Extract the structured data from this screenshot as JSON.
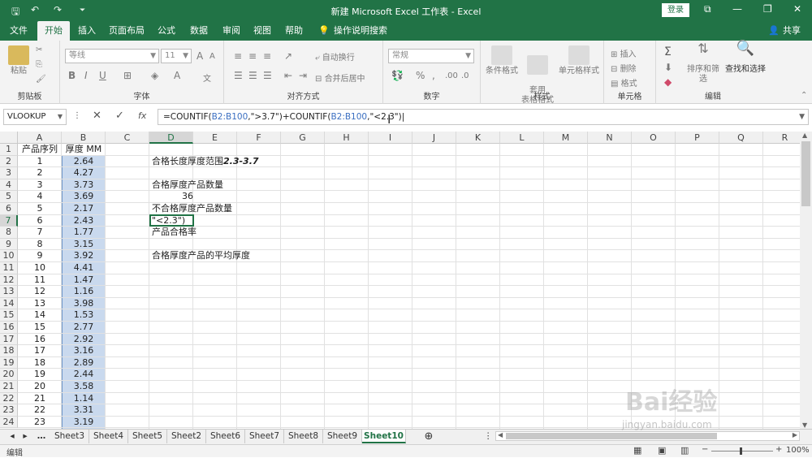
{
  "titlebar": {
    "title": "新建 Microsoft Excel 工作表 - Excel",
    "login": "登录",
    "qa_save": "🖫",
    "qa_undo": "↶",
    "qa_redo": "↷",
    "qa_custom": "⏷",
    "win_ribbon": "⧉",
    "win_min": "—",
    "win_max": "❐",
    "win_close": "✕"
  },
  "tabs": [
    "文件",
    "开始",
    "插入",
    "页面布局",
    "公式",
    "数据",
    "审阅",
    "视图",
    "帮助"
  ],
  "tell_me": "操作说明搜索",
  "share": "共享",
  "ribbon": {
    "clipboard": {
      "label": "剪贴板",
      "paste": "粘贴"
    },
    "font": {
      "label": "字体",
      "font_name": "等线",
      "font_size": "11",
      "bold": "B",
      "italic": "I",
      "underline": "U",
      "grow": "A",
      "shrink": "A",
      "fill": "A"
    },
    "alignment": {
      "label": "对齐方式",
      "wrap": "自动换行",
      "merge": "合并后居中"
    },
    "number": {
      "label": "数字",
      "format": "常规",
      "percent": "%",
      "comma": ","
    },
    "styles": {
      "label": "样式",
      "conditional": "条件格式",
      "table": "套用\n表格格式",
      "cell": "单元格样式"
    },
    "cells": {
      "label": "单元格",
      "insert": "插入",
      "delete": "删除",
      "format": "格式"
    },
    "editing": {
      "label": "编辑",
      "sort": "排序和筛选",
      "find": "查找和选择"
    }
  },
  "formula_bar": {
    "name_box": "VLOOKUP",
    "cancel": "✕",
    "enter": "✓",
    "fx": "fx",
    "formula_parts": [
      "=COUNTIF(",
      "B2:B100",
      ",\">3.7\")+COUNTIF(",
      "B2:B100",
      ",\"<2.3\")"
    ]
  },
  "columns": [
    "A",
    "B",
    "C",
    "D",
    "E",
    "F",
    "G",
    "H",
    "I",
    "J",
    "K",
    "L",
    "M",
    "N",
    "O",
    "P",
    "Q",
    "R"
  ],
  "rows": [
    "1",
    "2",
    "3",
    "4",
    "5",
    "6",
    "7",
    "8",
    "9",
    "10",
    "11",
    "12",
    "13",
    "14",
    "15",
    "16",
    "17",
    "18",
    "19",
    "20",
    "21",
    "22",
    "23",
    "24"
  ],
  "header_a": "产品序列",
  "header_b": "厚度 MM",
  "col_a": [
    "1",
    "2",
    "3",
    "4",
    "5",
    "6",
    "7",
    "8",
    "9",
    "10",
    "11",
    "12",
    "13",
    "14",
    "15",
    "16",
    "17",
    "18",
    "19",
    "20",
    "21",
    "22",
    "23"
  ],
  "col_b": [
    "2.64",
    "4.27",
    "3.73",
    "3.69",
    "2.17",
    "2.43",
    "1.77",
    "3.15",
    "3.92",
    "4.41",
    "1.47",
    "1.16",
    "3.98",
    "1.53",
    "2.77",
    "2.92",
    "3.16",
    "2.89",
    "2.44",
    "3.58",
    "1.14",
    "3.31",
    "3.19"
  ],
  "d_cells": {
    "d2_prefix": "合格长度厚度范围",
    "d2_range": "2.3-3.7",
    "d4": "合格厚度产品数量",
    "d5": "36",
    "d6": "不合格厚度产品数量",
    "d7": "\"<2.3\")",
    "d8": "产品合格率",
    "d10": "合格厚度产品的平均厚度"
  },
  "sheets": [
    "Sheet3",
    "Sheet4",
    "Sheet5",
    "Sheet2",
    "Sheet6",
    "Sheet7",
    "Sheet8",
    "Sheet9",
    "Sheet10"
  ],
  "active_sheet": "Sheet10",
  "status": {
    "mode": "编辑",
    "zoom": "100%"
  },
  "watermark": {
    "brand": "Bai经验",
    "url": "jingyan.baidu.com"
  }
}
